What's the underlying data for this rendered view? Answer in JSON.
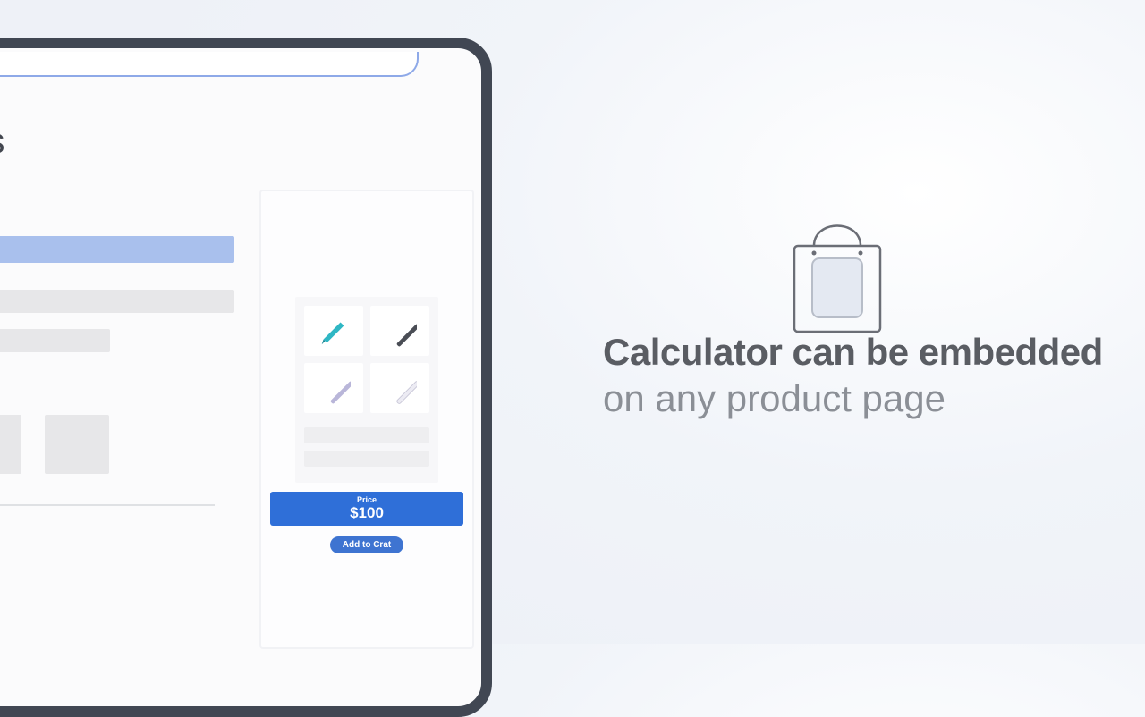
{
  "page": {
    "title_fragment": "nts"
  },
  "calculator": {
    "price_label": "Price",
    "price_value": "$100",
    "add_button": "Add to Crat"
  },
  "marketing": {
    "line1": "Calculator can be embedded",
    "line2": "on any product page"
  },
  "icons": {
    "bag": "shopping-bag-icon",
    "pen_cyan": "pen-swatch-cyan",
    "pen_black": "pen-swatch-black",
    "pen_lavender": "pen-swatch-lavender",
    "pen_white": "pen-swatch-white"
  },
  "colors": {
    "accent": "#2f6fd8",
    "device_border": "#414753"
  }
}
